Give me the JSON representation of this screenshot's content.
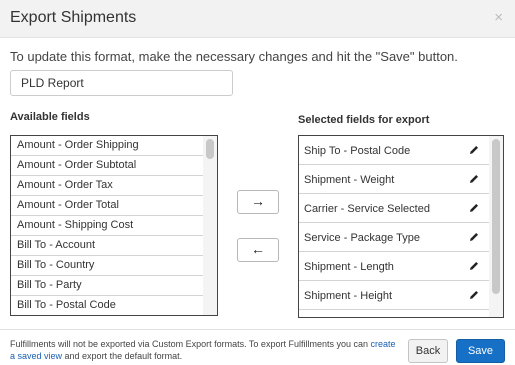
{
  "dialog": {
    "title": "Export Shipments",
    "close_glyph": "×"
  },
  "instruction": "To update this format, make the necessary changes and hit the \"Save\" button.",
  "format_name": {
    "value": "PLD Report"
  },
  "available": {
    "label": "Available fields",
    "items": [
      "Amount - Order Shipping",
      "Amount - Order Subtotal",
      "Amount - Order Tax",
      "Amount - Order Total",
      "Amount - Shipping Cost",
      "Bill To - Account",
      "Bill To - Country",
      "Bill To - Party",
      "Bill To - Postal Code"
    ]
  },
  "move_right_glyph": "→",
  "move_left_glyph": "←",
  "selected": {
    "label": "Selected fields for export",
    "items": [
      "Ship To - Postal Code",
      "Shipment - Weight",
      "Carrier - Service Selected",
      "Service - Package Type",
      "Shipment - Length",
      "Shipment - Height"
    ],
    "edit_icon": "pencil-icon"
  },
  "footer": {
    "text_before": "Fulfillments will not be exported via Custom Export formats. To export Fulfillments you can ",
    "link_text": "create a saved view",
    "text_after": " and export the default format."
  },
  "buttons": {
    "back": "Back",
    "save": "Save"
  },
  "colors": {
    "save_bg": "#1670c5",
    "link": "#1a5fb4",
    "header_bg": "#f2f2f2"
  }
}
